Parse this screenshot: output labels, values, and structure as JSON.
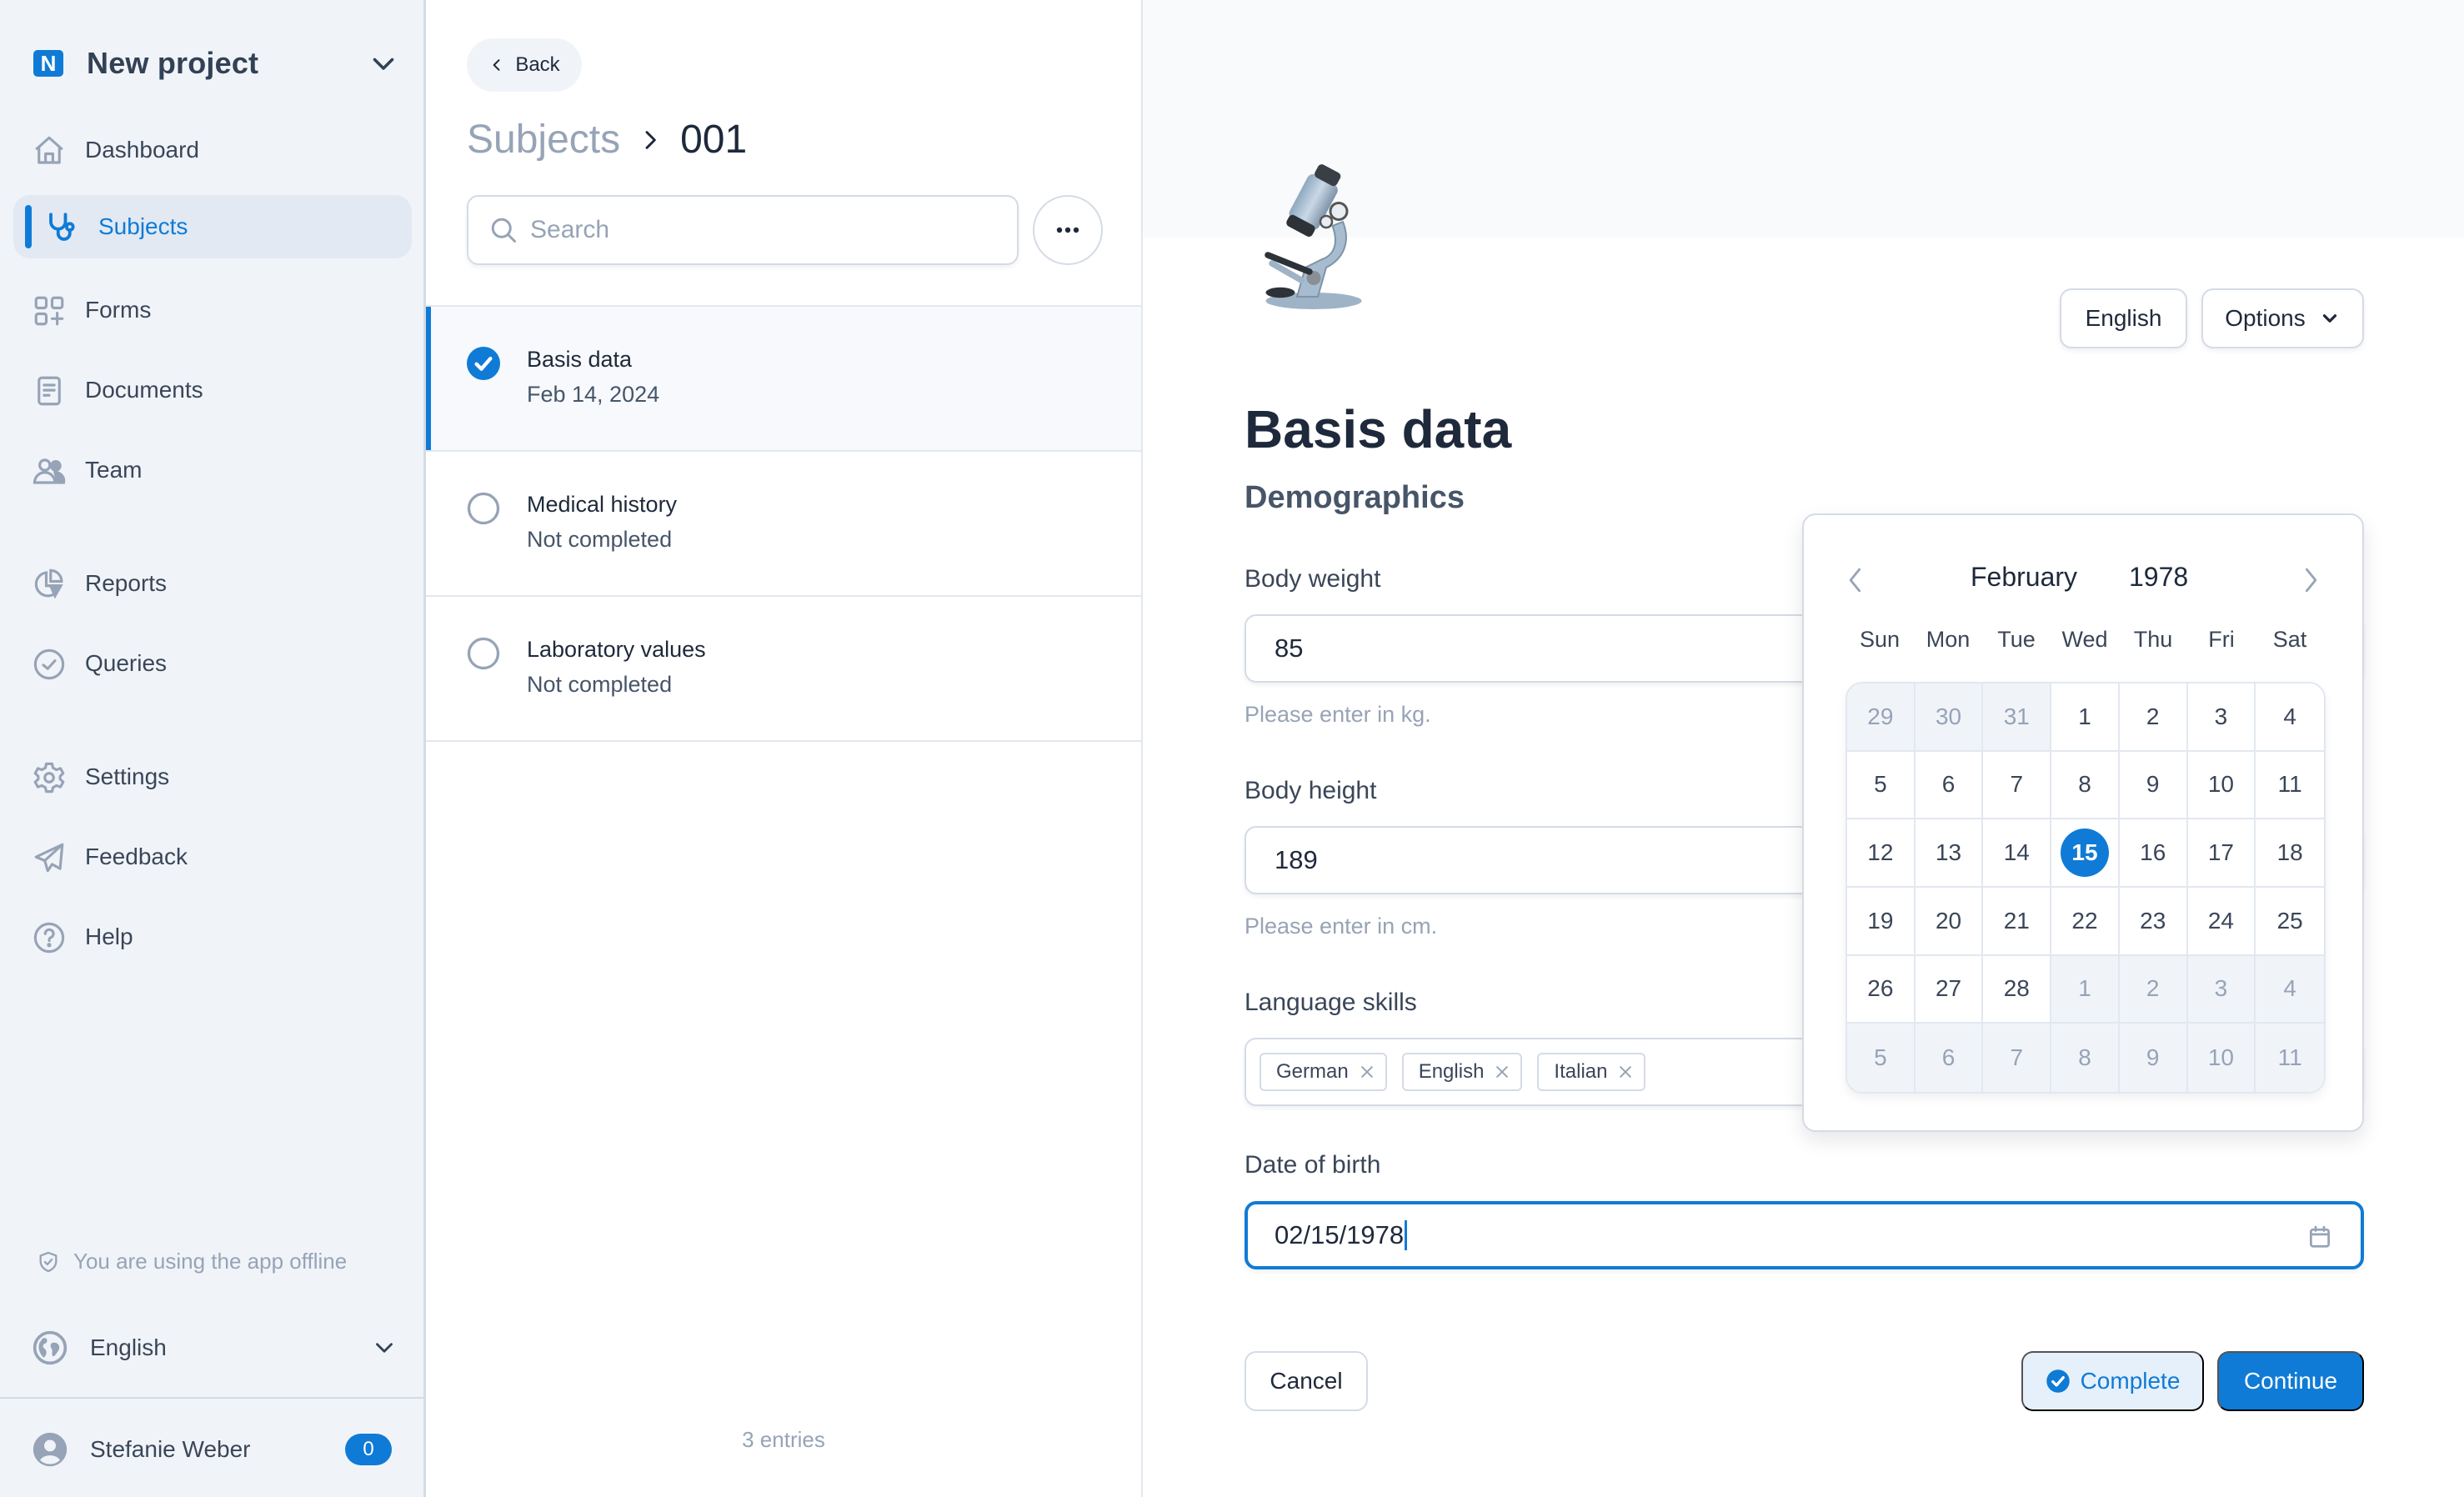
{
  "sidebar": {
    "project": {
      "logo_letter": "N",
      "name": "New project"
    },
    "nav": [
      {
        "label": "Dashboard",
        "icon": "home-icon"
      },
      {
        "label": "Subjects",
        "icon": "stethoscope-icon",
        "active": true
      },
      {
        "label": "Forms",
        "icon": "forms-grid-icon"
      },
      {
        "label": "Documents",
        "icon": "document-icon"
      },
      {
        "label": "Team",
        "icon": "team-icon"
      },
      {
        "label": "Reports",
        "icon": "pie-chart-icon"
      },
      {
        "label": "Queries",
        "icon": "check-circle-icon"
      },
      {
        "label": "Settings",
        "icon": "gear-icon"
      },
      {
        "label": "Feedback",
        "icon": "paper-plane-icon"
      },
      {
        "label": "Help",
        "icon": "help-circle-icon"
      }
    ],
    "offline_notice": "You are using the app offline",
    "language": "English",
    "user": {
      "name": "Stefanie Weber",
      "notification_count": "0"
    }
  },
  "middle": {
    "back_label": "Back",
    "breadcrumb": {
      "parent": "Subjects",
      "current": "001"
    },
    "search": {
      "placeholder": "Search",
      "value": ""
    },
    "forms": [
      {
        "title": "Basis data",
        "subtitle": "Feb 14, 2024",
        "completed": true,
        "selected": true
      },
      {
        "title": "Medical history",
        "subtitle": "Not completed",
        "completed": false,
        "selected": false
      },
      {
        "title": "Laboratory values",
        "subtitle": "Not completed",
        "completed": false,
        "selected": false
      }
    ],
    "entries_count": "3 entries"
  },
  "main": {
    "icon": "microscope-icon",
    "language_button": "English",
    "options_button": "Options",
    "title": "Basis data",
    "section": "Demographics",
    "fields": {
      "body_weight": {
        "label": "Body weight",
        "value": "85",
        "help": "Please enter in kg."
      },
      "body_height": {
        "label": "Body height",
        "value": "189",
        "help": "Please enter in cm."
      },
      "language_skills": {
        "label": "Language skills",
        "tags": [
          "German",
          "English",
          "Italian"
        ]
      },
      "date_of_birth": {
        "label": "Date of birth",
        "value": "02/15/1978"
      }
    },
    "actions": {
      "cancel": "Cancel",
      "complete": "Complete",
      "continue": "Continue"
    }
  },
  "datepicker": {
    "month": "February",
    "year": "1978",
    "weekdays": [
      "Sun",
      "Mon",
      "Tue",
      "Wed",
      "Thu",
      "Fri",
      "Sat"
    ],
    "selected_day": "15",
    "days": [
      {
        "d": "29",
        "out": true
      },
      {
        "d": "30",
        "out": true
      },
      {
        "d": "31",
        "out": true
      },
      {
        "d": "1"
      },
      {
        "d": "2"
      },
      {
        "d": "3"
      },
      {
        "d": "4"
      },
      {
        "d": "5"
      },
      {
        "d": "6"
      },
      {
        "d": "7"
      },
      {
        "d": "8"
      },
      {
        "d": "9"
      },
      {
        "d": "10"
      },
      {
        "d": "11"
      },
      {
        "d": "12"
      },
      {
        "d": "13"
      },
      {
        "d": "14"
      },
      {
        "d": "15",
        "sel": true
      },
      {
        "d": "16"
      },
      {
        "d": "17"
      },
      {
        "d": "18"
      },
      {
        "d": "19"
      },
      {
        "d": "20"
      },
      {
        "d": "21"
      },
      {
        "d": "22"
      },
      {
        "d": "23"
      },
      {
        "d": "24"
      },
      {
        "d": "25"
      },
      {
        "d": "26"
      },
      {
        "d": "27"
      },
      {
        "d": "28"
      },
      {
        "d": "1",
        "out": true
      },
      {
        "d": "2",
        "out": true
      },
      {
        "d": "3",
        "out": true
      },
      {
        "d": "4",
        "out": true
      },
      {
        "d": "5",
        "out": true
      },
      {
        "d": "6",
        "out": true
      },
      {
        "d": "7",
        "out": true
      },
      {
        "d": "8",
        "out": true
      },
      {
        "d": "9",
        "out": true
      },
      {
        "d": "10",
        "out": true
      },
      {
        "d": "11",
        "out": true
      }
    ]
  },
  "colors": {
    "accent": "#0f7bd6",
    "sidebar_bg": "#f0f4f9",
    "muted_text": "#97a3b6",
    "border": "#d4dbe6"
  }
}
